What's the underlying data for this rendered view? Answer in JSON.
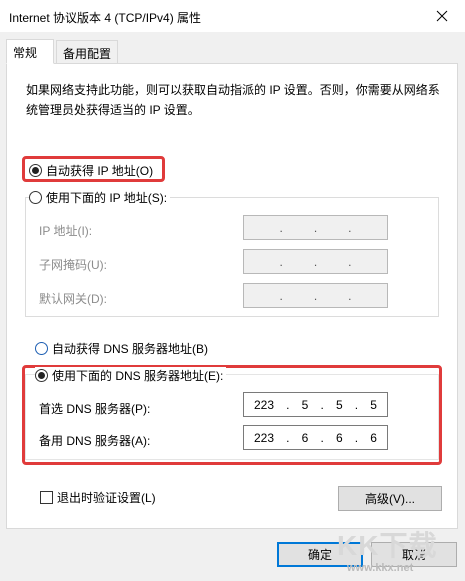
{
  "window": {
    "title": "Internet 协议版本 4 (TCP/IPv4) 属性"
  },
  "tabs": [
    {
      "label": "常规"
    },
    {
      "label": "备用配置"
    }
  ],
  "description": "如果网络支持此功能，则可以获取自动指派的 IP 设置。否则，你需要从网络系统管理员处获得适当的 IP 设置。",
  "ip": {
    "auto_label": "自动获得 IP 地址(O)",
    "manual_label": "使用下面的 IP 地址(S):",
    "address_label": "IP 地址(I):",
    "subnet_label": "子网掩码(U):",
    "gateway_label": "默认网关(D):",
    "empty_ip": [
      ".",
      ".",
      "."
    ]
  },
  "dns": {
    "auto_label": "自动获得 DNS 服务器地址(B)",
    "manual_label": "使用下面的 DNS 服务器地址(E):",
    "preferred_label": "首选 DNS 服务器(P):",
    "alternate_label": "备用 DNS 服务器(A):",
    "preferred": [
      "223",
      ".",
      "5",
      ".",
      "5",
      ".",
      "5"
    ],
    "alternate": [
      "223",
      ".",
      "6",
      ".",
      "6",
      ".",
      "6"
    ]
  },
  "validate_label": "退出时验证设置(L)",
  "advanced_label": "高级(V)...",
  "ok_label": "确定",
  "cancel_label": "取消",
  "watermark": {
    "logo": "KK下载",
    "url": "www.kkx.net"
  },
  "colors": {
    "highlight": "#e03b3b",
    "default_button": "#0078d7"
  }
}
